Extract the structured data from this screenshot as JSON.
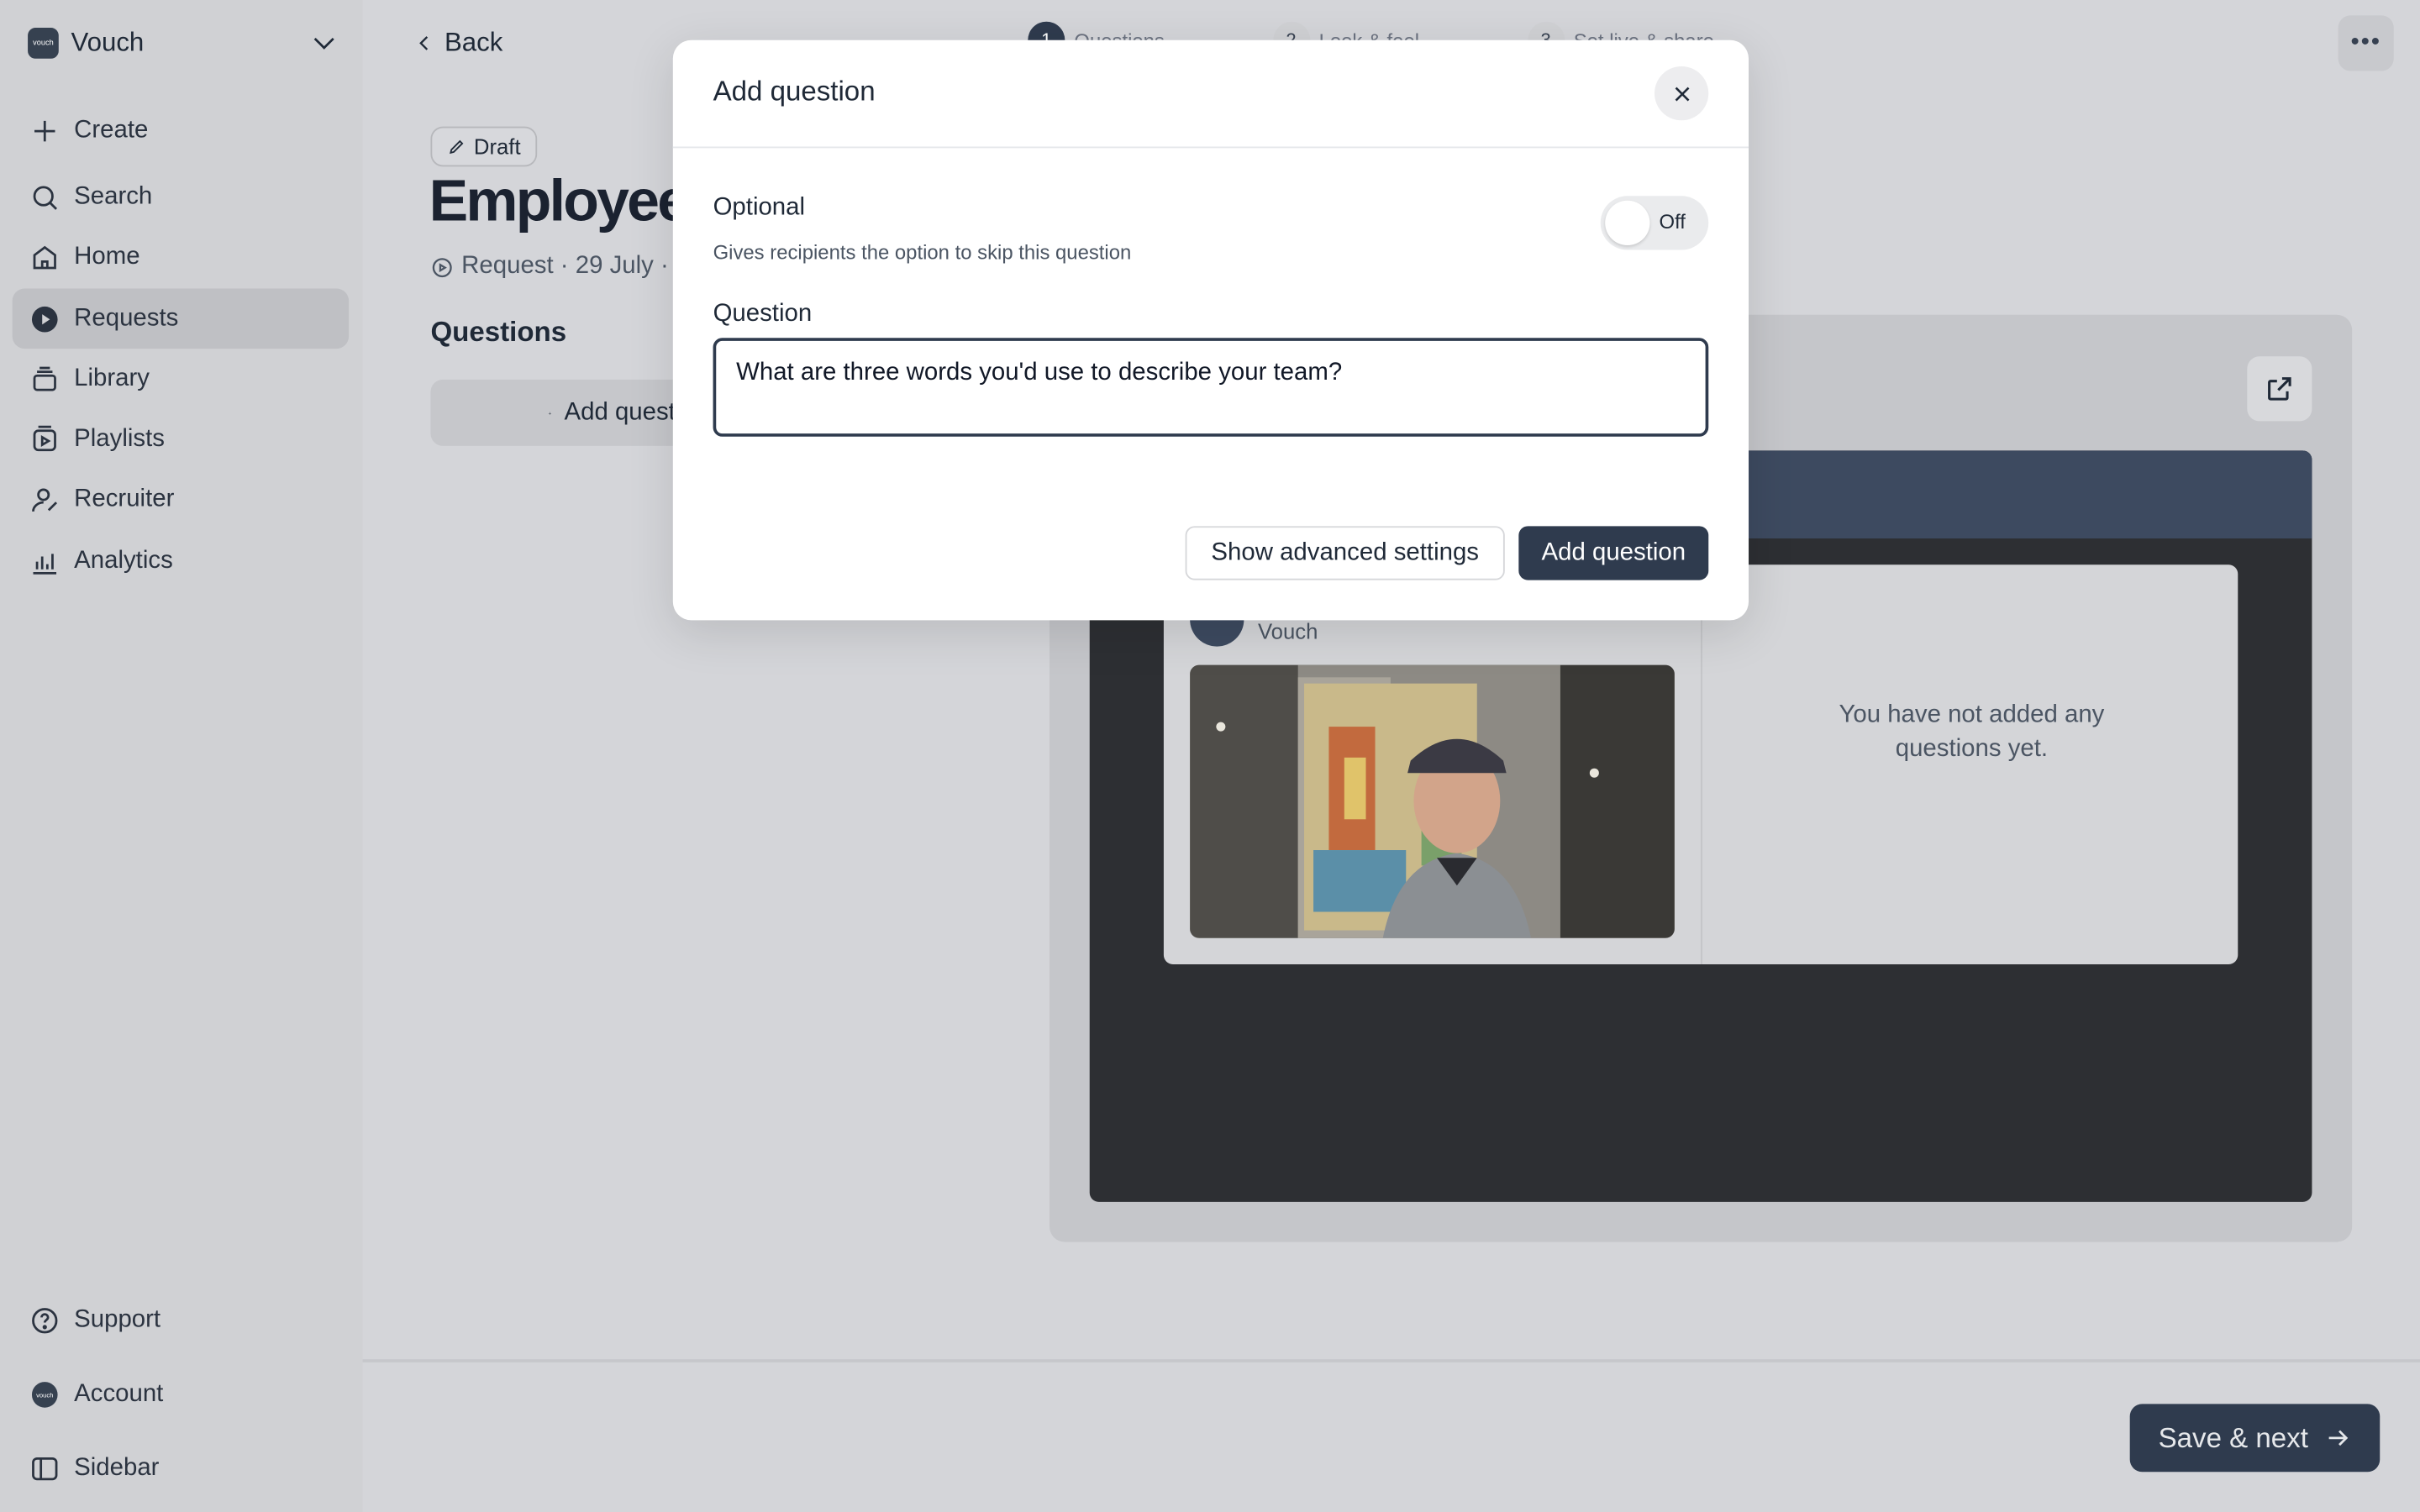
{
  "sidebar": {
    "workspace": {
      "logo_text": "vouch",
      "name": "Vouch"
    },
    "items": [
      {
        "label": "Create",
        "icon": "plus-icon"
      },
      {
        "label": "Search",
        "icon": "search-icon"
      },
      {
        "label": "Home",
        "icon": "home-icon"
      },
      {
        "label": "Requests",
        "icon": "requests-icon",
        "active": true
      },
      {
        "label": "Library",
        "icon": "library-icon"
      },
      {
        "label": "Playlists",
        "icon": "playlist-icon"
      },
      {
        "label": "Recruiter",
        "icon": "recruiter-icon"
      },
      {
        "label": "Analytics",
        "icon": "analytics-icon"
      }
    ],
    "bottom": [
      {
        "label": "Support",
        "icon": "help-icon"
      },
      {
        "label": "Account",
        "icon": "avatar"
      },
      {
        "label": "Sidebar",
        "icon": "sidebar-icon"
      }
    ]
  },
  "header": {
    "back_label": "Back",
    "steps": [
      {
        "num": "1",
        "label": "Questions",
        "active": true
      },
      {
        "num": "2",
        "label": "Look & feel"
      },
      {
        "num": "3",
        "label": "Set live & share"
      }
    ],
    "more_label": "•••"
  },
  "page": {
    "status_badge": "Draft",
    "title": "Employee Spotlight",
    "meta": "Request · 29 July ·",
    "questions_heading": "Questions",
    "add_question_label": "Add question"
  },
  "preview": {
    "org_name": "Vouch",
    "avatar_text": "vouch",
    "empty_message": "You have not added any questions yet."
  },
  "footer": {
    "save_next_label": "Save & next"
  },
  "modal": {
    "title": "Add question",
    "optional_label": "Optional",
    "optional_description": "Gives recipients the option to skip this question",
    "toggle_state": "Off",
    "question_label": "Question",
    "question_value": "What are three words you'd use to describe your team?",
    "advanced_button": "Show advanced settings",
    "submit_button": "Add question"
  },
  "colors": {
    "accent": "#2f3b4e",
    "backdrop": "#d4d5d9",
    "preview_band": "#3d4a60"
  }
}
